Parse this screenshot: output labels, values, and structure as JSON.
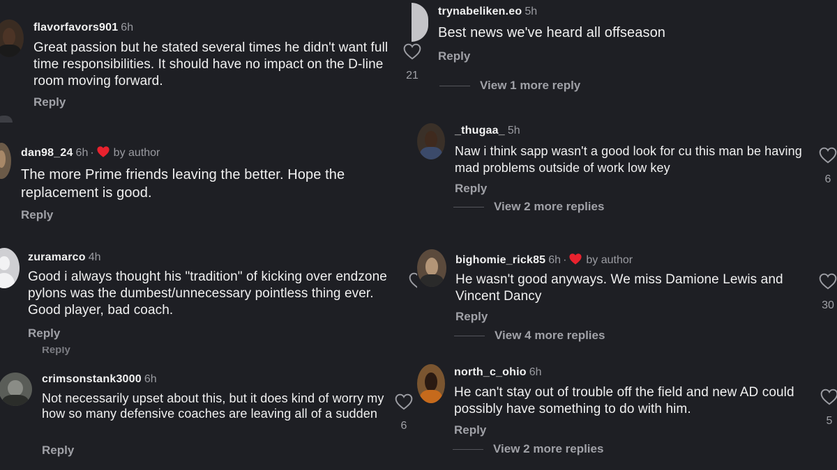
{
  "left_column": [
    {
      "username": "flavorfavors901",
      "time": "6h",
      "author_liked": false,
      "text": "Great passion but he stated several times he didn't want full time responsibilities. It should have no impact on the D-line room moving forward.",
      "reply_label": "Reply",
      "likes": "21"
    },
    {
      "username": "dan98_24",
      "time": "6h",
      "author_liked": true,
      "by_author_label": "by author",
      "text": "The more Prime friends leaving the better. Hope the replacement is good.",
      "reply_label": "Reply"
    },
    {
      "username": "zuramarco",
      "time": "4h",
      "author_liked": false,
      "text": "Good i always thought his \"tradition\" of kicking over endzone pylons was the dumbest/unnecessary pointless thing ever. Good player, bad coach.",
      "reply_label": "Reply",
      "cut_label": "Reply"
    },
    {
      "username": "crimsonstank3000",
      "time": "6h",
      "author_liked": false,
      "text": "Not necessarily upset about this, but it does kind of worry my how so many defensive coaches are leaving all of a sudden",
      "reply_label": "Reply",
      "likes": "6"
    }
  ],
  "right_column": [
    {
      "username": "trynabeliken.eo",
      "time": "5h",
      "author_liked": false,
      "text": "Best news we've heard all offseason",
      "reply_label": "Reply",
      "view_more": "View 1 more reply"
    },
    {
      "username": "_thugaa_",
      "time": "5h",
      "author_liked": false,
      "text": "Naw i think sapp wasn't a good look for cu this man be having mad problems outside of work low key",
      "reply_label": "Reply",
      "view_more": "View 2 more replies",
      "likes": "6"
    },
    {
      "username": "bighomie_rick85",
      "time": "6h",
      "author_liked": true,
      "by_author_label": "by author",
      "text": "He wasn't good anyways. We miss Damione Lewis and Vincent Dancy",
      "reply_label": "Reply",
      "view_more": "View 4 more replies",
      "likes": "30"
    },
    {
      "username": "north_c_ohio",
      "time": "6h",
      "author_liked": false,
      "text": "He can't stay out of trouble off the field and new AD could possibly have something to do with him.",
      "reply_label": "Reply",
      "view_more": "View 2 more replies",
      "likes": "5"
    }
  ],
  "colors": {
    "background": "#1e1f24",
    "heart_red": "#e8222e",
    "secondary_text": "#a0a1a7"
  }
}
